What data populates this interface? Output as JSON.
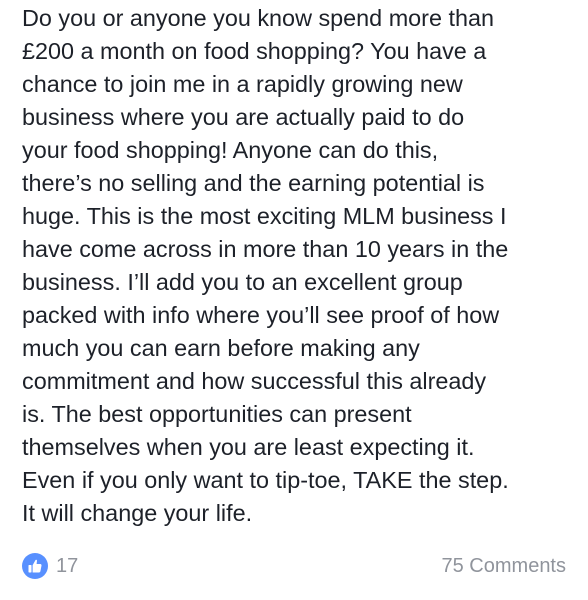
{
  "post": {
    "lines": [
      "Do you or anyone you know spend more than",
      "£200 a month on food shopping? You have a",
      "chance to join me in a rapidly growing new",
      "business where you are actually paid to do",
      "your food shopping! Anyone can do this,",
      "there’s no selling and the earning potential is",
      "huge. This is the most exciting MLM business I",
      "have come across in more than 10 years in the",
      "business. I’ll add you to an excellent group",
      "packed with info where you’ll see proof of how",
      "much you can earn before making any",
      "commitment and how successful this already",
      "is. The best opportunities can present",
      "themselves when you are least expecting it.",
      "Even if you only want to tip-toe, TAKE the step.",
      "It will change your life."
    ]
  },
  "footer": {
    "like_count": "17",
    "like_icon": "thumbs-up-icon",
    "comments_label": "75 Comments"
  },
  "colors": {
    "text": "#1d2129",
    "meta": "#90949c",
    "like_badge": "#5890ff"
  }
}
